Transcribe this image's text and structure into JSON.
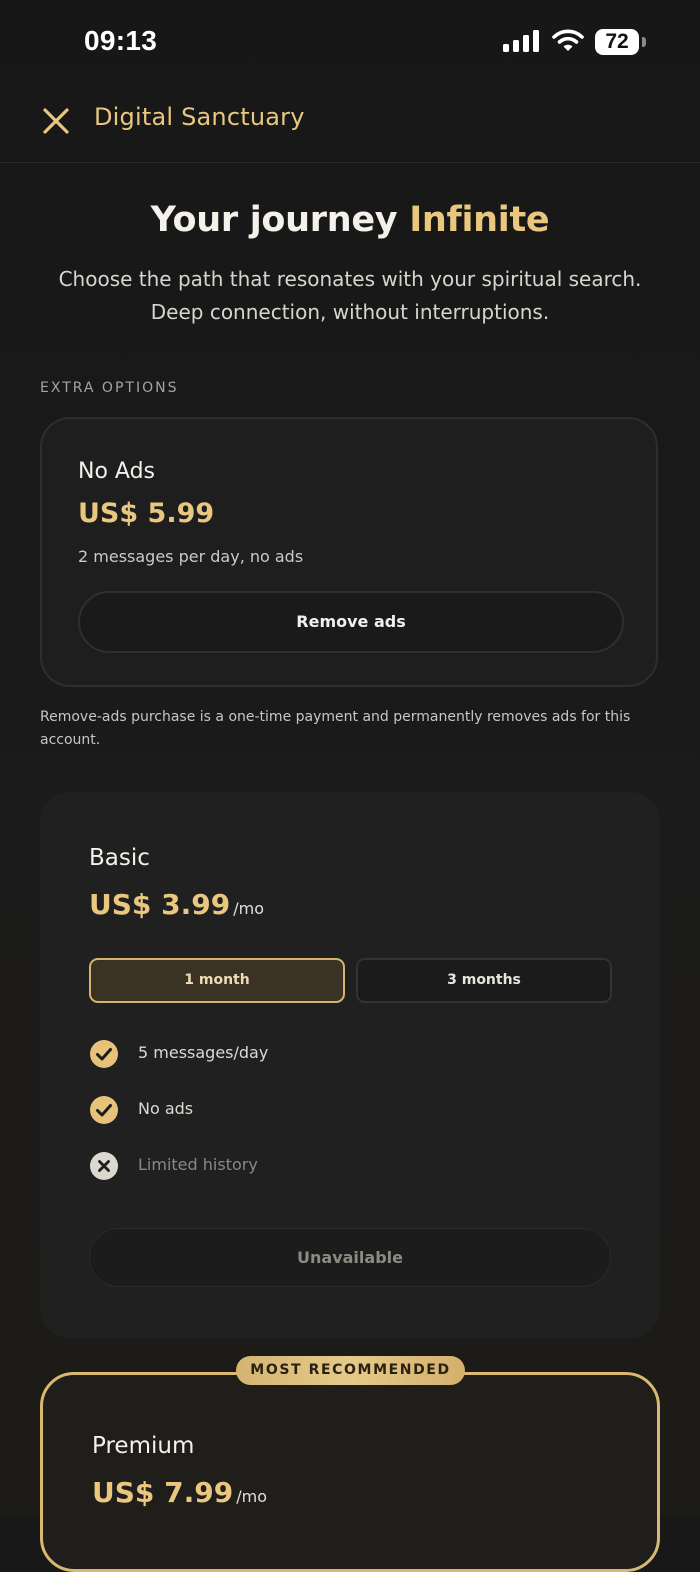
{
  "status_bar": {
    "time": "09:13",
    "battery": "72",
    "icons": [
      "signal-icon",
      "wifi-icon",
      "battery-icon"
    ]
  },
  "header": {
    "title": "Digital Sanctuary",
    "close_icon": "close-icon"
  },
  "hero": {
    "title_main": "Your journey",
    "title_accent": "Infinite",
    "subtitle": "Choose the path that resonates with your spiritual search. Deep connection, without interruptions."
  },
  "extra_options": {
    "label": "EXTRA OPTIONS",
    "card": {
      "title": "No Ads",
      "price": "US$ 5.99",
      "description": "2 messages per day, no ads",
      "button": "Remove ads"
    },
    "note": "Remove-ads purchase is a one-time payment and permanently removes ads for this account."
  },
  "plans": [
    {
      "name": "Basic",
      "price": "US$ 3.99",
      "per": "/mo",
      "periods": [
        "1 month",
        "3 months"
      ],
      "selected_period": "1 month",
      "features": [
        {
          "text": "5 messages/day",
          "included": true,
          "icon": "check-circle-icon"
        },
        {
          "text": "No ads",
          "included": true,
          "icon": "check-circle-icon"
        },
        {
          "text": "Limited history",
          "included": false,
          "icon": "x-circle-icon"
        }
      ],
      "button": "Unavailable"
    },
    {
      "badge": "MOST RECOMMENDED",
      "name": "Premium",
      "price": "US$ 7.99",
      "per": "/mo"
    }
  ],
  "colors": {
    "accent": "#e9c77f",
    "background": "#181818",
    "card": "#202020",
    "text": "#f2f0eb",
    "muted": "#8b8882"
  }
}
